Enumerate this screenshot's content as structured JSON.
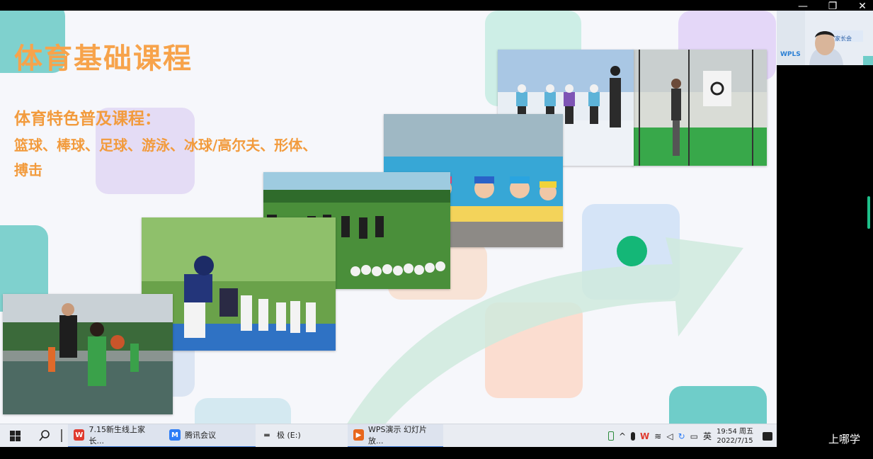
{
  "window": {
    "controls": {
      "minimize": "—",
      "restore": "❐",
      "close": "✕"
    }
  },
  "slide": {
    "title": "体育基础课程",
    "subtitle": "体育特色普及课程：",
    "body": "篮球、棒球、足球、游泳、冰球/高尔夫、形体、搏击",
    "colors": {
      "title": "#f7a34b",
      "accent_green": "#14b777",
      "arrow": "#cfeadd"
    },
    "photos": [
      {
        "name": "basketball-photo",
        "subject": "basketball"
      },
      {
        "name": "baseball-photo",
        "subject": "baseball"
      },
      {
        "name": "football-photo",
        "subject": "football"
      },
      {
        "name": "swimming-photo",
        "subject": "swimming"
      },
      {
        "name": "icehockey-photo",
        "subject": "ice hockey"
      },
      {
        "name": "golf-photo",
        "subject": "golf"
      }
    ]
  },
  "video": {
    "banner_text": "家长会",
    "logo_text": "WPLS"
  },
  "brand_label": "上哪学",
  "taskbar": {
    "start_icon": "windows-icon",
    "search_icon": "search-icon",
    "tasks": [
      {
        "label": "7.15新生线上家长...",
        "icon": "wps-icon",
        "icon_text": "W",
        "color": "#e03a2f",
        "active": true
      },
      {
        "label": "腾讯会议",
        "icon": "tencent-meeting-icon",
        "icon_text": "M",
        "color": "#2e7df6",
        "active": true
      },
      {
        "label": "极 (E:)",
        "icon": "drive-icon",
        "icon_text": "▬",
        "color": "#888888",
        "active": false
      },
      {
        "label": "WPS演示 幻灯片放...",
        "icon": "wps-presentation-icon",
        "icon_text": "▶",
        "color": "#e8671d",
        "active": true
      }
    ],
    "tray": {
      "ime": "英",
      "time": "19:54 周五",
      "date": "2022/7/15"
    }
  }
}
